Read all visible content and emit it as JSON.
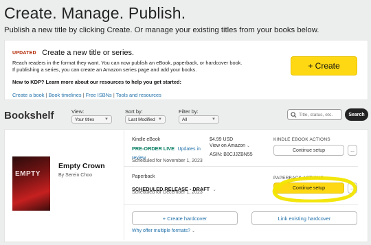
{
  "header": {
    "title": "Create. Manage. Publish.",
    "subtitle": "Publish a new title by clicking Create. Or manage your existing titles from your books below."
  },
  "promo": {
    "badge": "UPDATED",
    "heading": "Create a new title or series.",
    "paragraph": "Reach readers in the format they want. You can now publish an eBook, paperback, or hardcover book. If publishing a series, you can create an Amazon series page and add your books.",
    "learn_more": "New to KDP? Learn more about our resources to help you get started:",
    "links": [
      "Create a book",
      "Book timelines",
      "Free ISBNs",
      "Tools and resources"
    ],
    "create_button": "+ Create"
  },
  "bookshelf": {
    "title": "Bookshelf",
    "filters": {
      "view": {
        "label": "View:",
        "value": "Your titles"
      },
      "sort": {
        "label": "Sort by:",
        "value": "Last Modified"
      },
      "filter": {
        "label": "Filter by:",
        "value": "All"
      }
    },
    "search": {
      "placeholder": "Title, status, etc.",
      "button": "Search"
    }
  },
  "book": {
    "cover_text": "EMPTY",
    "title": "Empty Crown",
    "author": "By Serein Choo",
    "ebook": {
      "format": "Kindle eBook",
      "status": "PRE-ORDER LIVE",
      "status_link": "Updates in review",
      "scheduled": "Scheduled for November 1, 2023",
      "price": "$4.99 USD",
      "view_link": "View on Amazon",
      "asin": "ASIN: B0CJJZBN55",
      "actions_label": "KINDLE EBOOK ACTIONS",
      "action_button": "Continue setup",
      "more": "..."
    },
    "paperback": {
      "format": "Paperback",
      "status": "SCHEDULED RELEASE - DRAFT",
      "scheduled": "Scheduled for December 1, 2023",
      "actions_label": "PAPERBACK ACTIONS",
      "action_button": "Continue setup",
      "more": "..."
    },
    "hardcover": {
      "create_button": "+ Create hardcover",
      "link_button": "Link existing hardcover",
      "why_link": "Why offer multiple formats?"
    }
  },
  "colors": {
    "accent_yellow": "#ffd814",
    "link_blue": "#1e6fa8",
    "status_green": "#067d62",
    "highlight": "#f2e500"
  }
}
